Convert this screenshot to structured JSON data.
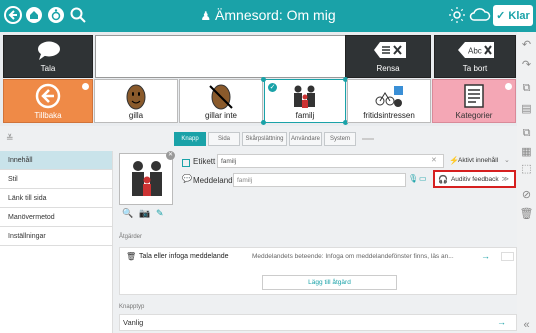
{
  "header": {
    "title": "Ämnesord: Om mig",
    "edit_label": "✓ Klar",
    "icons": [
      "back-circle-icon",
      "home-icon",
      "wheelchair-icon",
      "search-icon",
      "sun-icon",
      "cloud-icon"
    ]
  },
  "row1": {
    "talk_label": "Tala",
    "clear_label": "Rensa",
    "delete_label": "Ta bort"
  },
  "row2": {
    "back_label": "Tillbaka",
    "tiles": [
      "gilla",
      "gillar inte",
      "familj",
      "fritidsintressen",
      "Kategorier"
    ]
  },
  "tabs": [
    "Knapp",
    "Sida",
    "Skårpslättning",
    "Användare",
    "System"
  ],
  "sidebar": {
    "items": [
      "Innehåll",
      "Stil",
      "Länk till sida",
      "Manövermetod",
      "Inställningar"
    ]
  },
  "main": {
    "label_etikett": "Etikett",
    "etikett_value": "familj",
    "label_meddelande": "Meddelande",
    "meddelande_placeholder": "familj",
    "aktivt_innehall": "Aktivt innehåll",
    "auditiv_feedback": "Auditiv feedback",
    "section_atgarder": "Åtgärder",
    "action_title": "Tala eller infoga meddelande",
    "action_desc": "Meddelandets beteende: Infoga om meddelandefönster finns, läs an...",
    "add_action": "Lägg till åtgärd",
    "section_knapptyp": "Knapptyp",
    "knapptyp_value": "Vanlig"
  },
  "colors": {
    "teal": "#1aa2a8",
    "orange": "#ef8a47",
    "pink": "#f4a7b5",
    "dark": "#2f3335",
    "red_outline": "#d62020"
  }
}
